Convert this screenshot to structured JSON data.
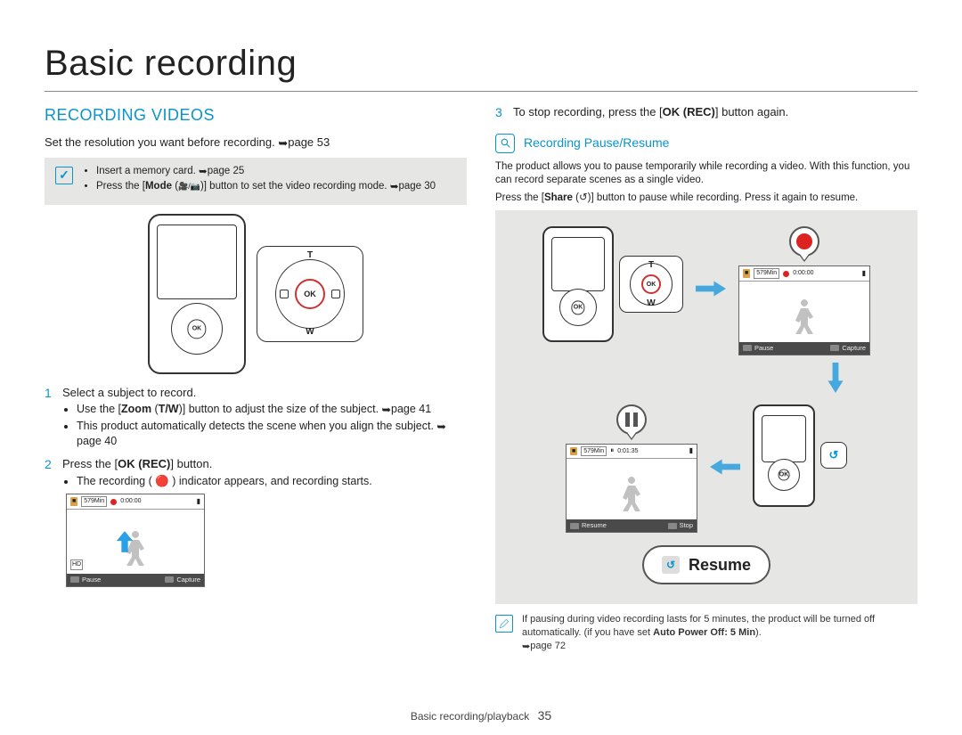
{
  "page": {
    "title": "Basic recording",
    "footer_section": "Basic recording/playback",
    "footer_page": "35"
  },
  "left": {
    "heading": "RECORDING VIDEOS",
    "intro_pre": "Set the resolution you want before recording. ",
    "intro_ref": "page 53",
    "note": {
      "bullet1_pre": "Insert a memory card. ",
      "bullet1_ref": "page 25",
      "bullet2_pre": "Press the [",
      "bullet2_mode": "Mode",
      "bullet2_mid": " (",
      "bullet2_icons": "🎥/📷",
      "bullet2_post1": ")] button to set the video recording mode. ",
      "bullet2_ref": "page 30"
    },
    "callout": {
      "ok_label": "OK",
      "t_label": "T",
      "w_label": "W"
    },
    "step1": {
      "num": "1",
      "text": "Select a subject to record.",
      "b1_pre": "Use the [",
      "b1_zoom": "Zoom",
      "b1_mid": " (",
      "b1_tw": "T/W",
      "b1_post": ")] button to adjust the size of the subject. ",
      "b1_ref": "page 41",
      "b2_pre": "This product automatically detects the scene when you align the subject. ",
      "b2_ref": "page 40"
    },
    "step2": {
      "num": "2",
      "text_pre": "Press the [",
      "text_ok": "OK (REC)",
      "text_post": "] button.",
      "b1": "The recording ( 🔴 ) indicator appears, and recording starts."
    },
    "lcd1": {
      "mem": "579Min",
      "time": "0:00:00",
      "bot_left": "Pause",
      "bot_right": "Capture",
      "hd": "HD"
    }
  },
  "right": {
    "step3": {
      "num": "3",
      "text_pre": "To stop recording, press the [",
      "text_ok": "OK (REC)",
      "text_post": "] button again."
    },
    "sub": {
      "title": "Recording Pause/Resume"
    },
    "sub_text_l1": "The product allows you to pause temporarily while recording a video. With this function, you can record separate scenes as a single video.",
    "sub_text_l2_pre": "Press the [",
    "sub_text_l2_share": "Share",
    "sub_text_l2_mid": " (",
    "sub_text_l2_icon": "↺",
    "sub_text_l2_post": ")] button to pause while recording. Press it again to resume.",
    "callout_small": {
      "ok_label": "OK",
      "t_label": "T",
      "w_label": "W"
    },
    "share_icon_label": "↺",
    "lcd_top": {
      "mem": "579Min",
      "time": "0:00:00",
      "bot_left": "Pause",
      "bot_right": "Capture"
    },
    "lcd_bottom": {
      "mem": "579Min",
      "time": "0:01:35",
      "bot_left": "Resume",
      "bot_right": "Stop"
    },
    "resume_label": "Resume",
    "footnote_pre": "If pausing during video recording lasts for 5 minutes, the product will be turned off automatically. (if you have set ",
    "footnote_bold": "Auto Power Off: 5 Min",
    "footnote_post": "). ",
    "footnote_ref": "page 72"
  }
}
